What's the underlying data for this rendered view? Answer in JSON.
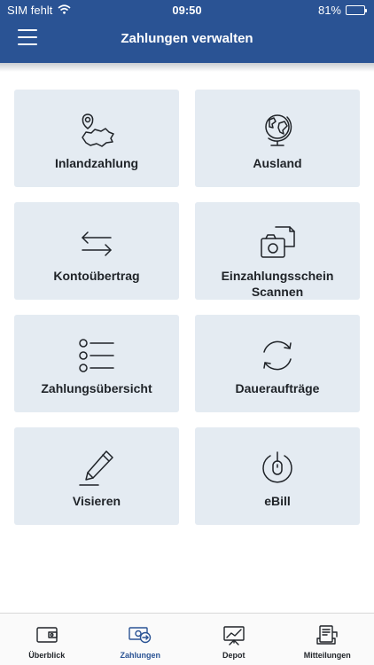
{
  "status_bar": {
    "carrier": "SIM fehlt",
    "time": "09:50",
    "battery": "81%",
    "battery_level": 0.81
  },
  "header": {
    "title": "Zahlungen verwalten"
  },
  "tiles": [
    {
      "label": "Inlandzahlung",
      "icon": "map-pin-icon"
    },
    {
      "label": "Ausland",
      "icon": "globe-icon"
    },
    {
      "label": "Kontoübertrag",
      "icon": "transfer-arrows-icon"
    },
    {
      "label": "Einzahlungsschein Scannen",
      "icon": "camera-scan-icon"
    },
    {
      "label": "Zahlungsübersicht",
      "icon": "list-icon"
    },
    {
      "label": "Daueraufträge",
      "icon": "recurring-icon"
    },
    {
      "label": "Visieren",
      "icon": "pen-icon"
    },
    {
      "label": "eBill",
      "icon": "ebill-icon"
    }
  ],
  "tabbar": {
    "active": "Zahlungen",
    "tabs": [
      {
        "label": "Überblick",
        "icon": "wallet-icon"
      },
      {
        "label": "Zahlungen",
        "icon": "payments-icon"
      },
      {
        "label": "Depot",
        "icon": "chart-board-icon"
      },
      {
        "label": "Mitteilungen",
        "icon": "messages-icon"
      }
    ]
  },
  "colors": {
    "primary": "#2a5394",
    "tile": "#e4ebf2",
    "icon": "#1f2328"
  }
}
